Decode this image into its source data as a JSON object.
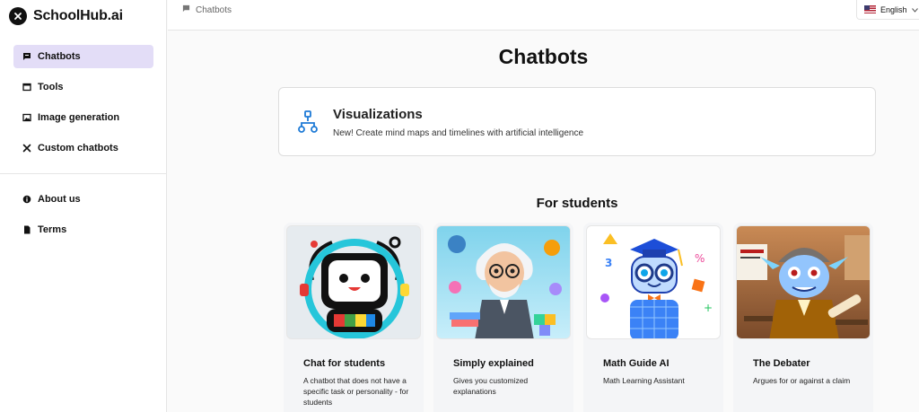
{
  "brand": {
    "name": "SchoolHub.ai"
  },
  "sidebar": {
    "items": [
      {
        "label": "Chatbots",
        "icon": "chat-icon",
        "active": true
      },
      {
        "label": "Tools",
        "icon": "window-icon",
        "active": false
      },
      {
        "label": "Image generation",
        "icon": "image-icon",
        "active": false
      },
      {
        "label": "Custom chatbots",
        "icon": "tools-icon",
        "active": false
      }
    ],
    "secondary": [
      {
        "label": "About us",
        "icon": "info-icon"
      },
      {
        "label": "Terms",
        "icon": "document-icon"
      }
    ]
  },
  "topbar": {
    "breadcrumb": "Chatbots",
    "language": "English"
  },
  "main": {
    "title": "Chatbots",
    "feature": {
      "title": "Visualizations",
      "description": "New! Create mind maps and timelines with artificial intelligence"
    },
    "section_title": "For students",
    "cards": [
      {
        "title": "Chat for students",
        "description": "A chatbot that does not have a specific task or personality - for students",
        "image": "robot-illustration"
      },
      {
        "title": "Simply explained",
        "description": "Gives you customized explanations",
        "image": "professor-illustration"
      },
      {
        "title": "Math Guide AI",
        "description": "Math Learning Assistant",
        "image": "math-robot-illustration"
      },
      {
        "title": "The Debater",
        "description": "Argues for or against a claim",
        "image": "debater-illustration"
      }
    ]
  },
  "colors": {
    "active_nav": "#e3ddf7",
    "accent_blue": "#1e7ad6",
    "card_bg": "#f4f5f7"
  }
}
